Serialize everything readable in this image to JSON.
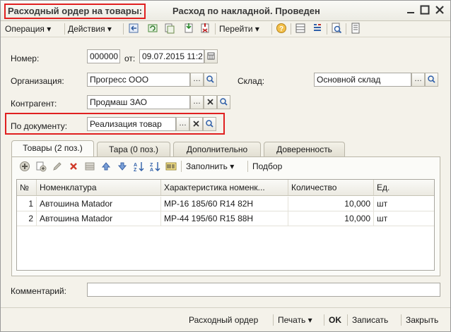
{
  "window": {
    "title_part1": "Расходный ордер на товары:",
    "title_part2": "Расход по накладной. Проведен"
  },
  "toolbar": {
    "operation_label": "Операция",
    "actions_label": "Действия",
    "goto_label": "Перейти"
  },
  "form": {
    "number_label": "Номер:",
    "number_value": "000000",
    "date_label": "от:",
    "date_value": "09.07.2015 11:2",
    "org_label": "Организация:",
    "org_value": "Прогресс ООО",
    "warehouse_label": "Склад:",
    "warehouse_value": "Основной склад",
    "counterparty_label": "Контрагент:",
    "counterparty_value": "Продмаш ЗАО",
    "document_label": "По документу:",
    "document_value": "Реализация товар",
    "comment_label": "Комментарий:",
    "comment_value": ""
  },
  "tabs": [
    {
      "label": "Товары (2 поз.)",
      "active": true
    },
    {
      "label": "Тара (0 поз.)",
      "active": false
    },
    {
      "label": "Дополнительно",
      "active": false
    },
    {
      "label": "Доверенность",
      "active": false
    }
  ],
  "table_toolbar": {
    "fill_label": "Заполнить",
    "select_label": "Подбор"
  },
  "table": {
    "columns": [
      "№",
      "Номенклатура",
      "Характеристика номенк...",
      "Количество",
      "Ед."
    ],
    "rows": [
      [
        "1",
        "Автошина Matador",
        "MP-16 185/60 R14 82H",
        "10,000",
        "шт"
      ],
      [
        "2",
        "Автошина Matador",
        "MP-44 195/60 R15 88H",
        "10,000",
        "шт"
      ]
    ]
  },
  "bottom": {
    "expense_order": "Расходный ордер",
    "print": "Печать",
    "ok": "OK",
    "save": "Записать",
    "close": "Закрыть"
  },
  "colors": {
    "highlight": "#e02020",
    "window_bg": "#f4f2ea"
  }
}
